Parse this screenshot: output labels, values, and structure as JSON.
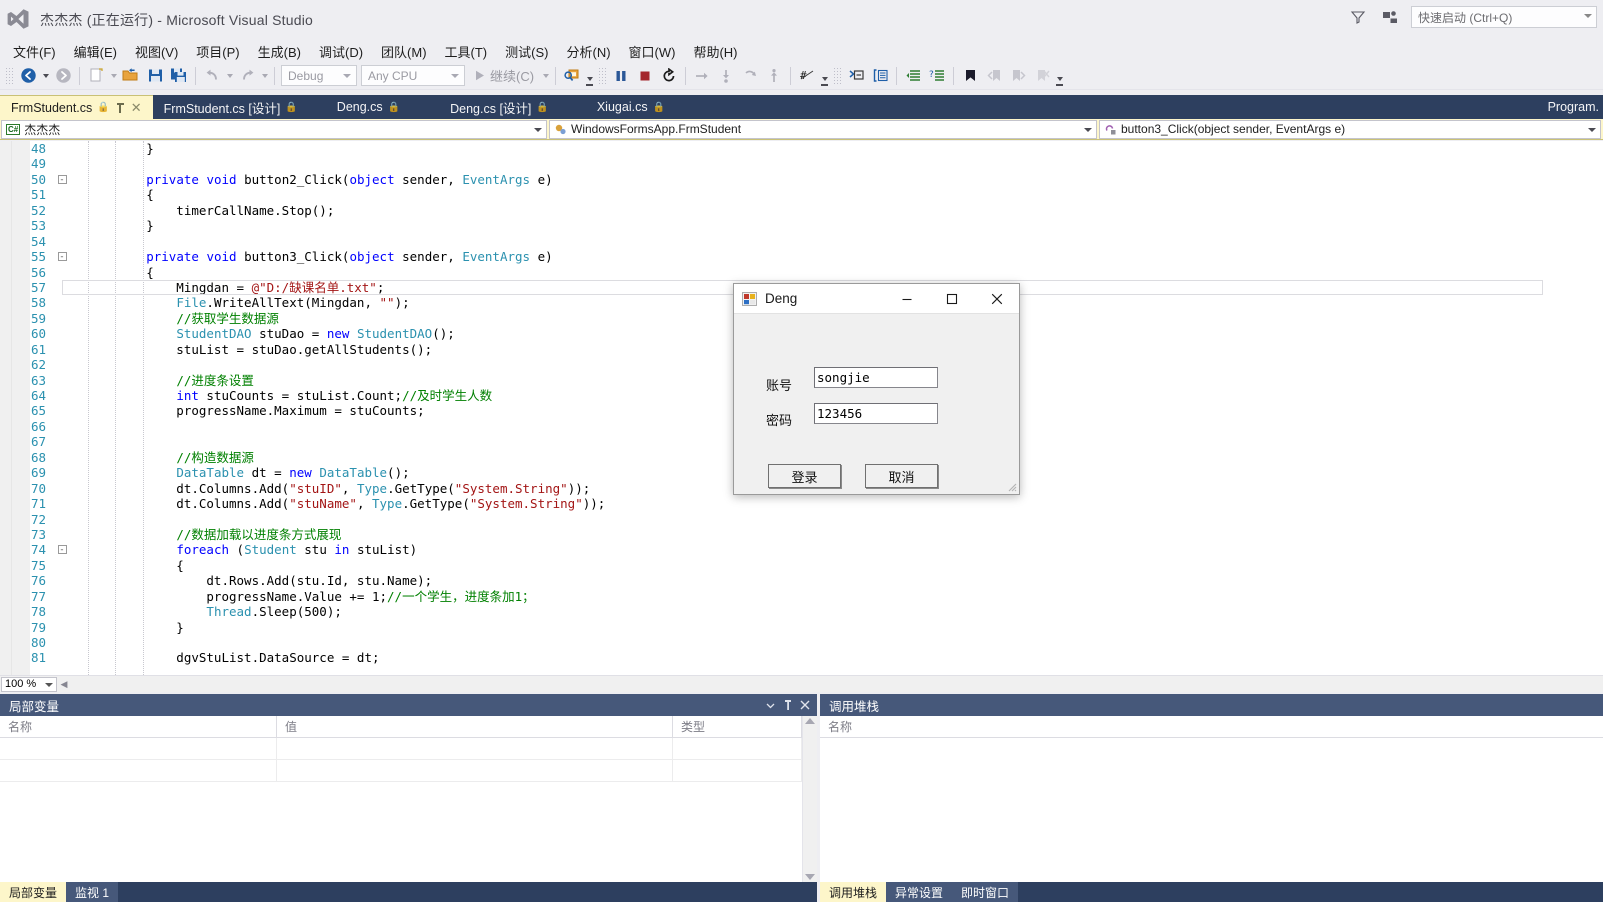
{
  "window": {
    "title": "杰杰杰 (正在运行) - Microsoft Visual Studio",
    "logo_icon": "visual-studio-logo",
    "feedback_icon": "feedback-icon",
    "notifications_icon": "notifications-icon",
    "quick_launch_placeholder": "快速启动 (Ctrl+Q)"
  },
  "menu": {
    "items": [
      {
        "label": "文件(F)"
      },
      {
        "label": "编辑(E)"
      },
      {
        "label": "视图(V)"
      },
      {
        "label": "项目(P)"
      },
      {
        "label": "生成(B)"
      },
      {
        "label": "调试(D)"
      },
      {
        "label": "团队(M)"
      },
      {
        "label": "工具(T)"
      },
      {
        "label": "测试(S)"
      },
      {
        "label": "分析(N)"
      },
      {
        "label": "窗口(W)"
      },
      {
        "label": "帮助(H)"
      }
    ]
  },
  "toolbar": {
    "config_value": "Debug",
    "platform_value": "Any CPU",
    "continue_label": "继续(C)",
    "icons": [
      "navigate-back-icon",
      "navigate-forward-icon",
      "new-project-icon",
      "open-file-icon",
      "save-icon",
      "save-all-icon",
      "undo-icon",
      "redo-icon",
      "start-debug-icon",
      "find-icon",
      "pause-icon",
      "stop-icon",
      "restart-icon",
      "step-over-icon",
      "step-into-icon",
      "step-out-icon",
      "show-next-statement-icon",
      "hex-display-icon",
      "comment-icon",
      "uncomment-icon",
      "decrease-indent-icon",
      "increase-indent-icon",
      "bookmark-icon",
      "prev-bookmark-icon",
      "next-bookmark-icon",
      "clear-bookmarks-icon"
    ]
  },
  "tabs": {
    "items": [
      {
        "label": "FrmStudent.cs",
        "active": true,
        "pinned": true,
        "locked": true
      },
      {
        "label": "FrmStudent.cs [设计]",
        "active": false,
        "locked": true
      },
      {
        "label": "Deng.cs",
        "active": false,
        "locked": true
      },
      {
        "label": "Deng.cs [设计]",
        "active": false,
        "locked": true
      },
      {
        "label": "Xiugai.cs",
        "active": false,
        "locked": true
      }
    ],
    "overflow_label": "Program."
  },
  "navbar": {
    "project": "杰杰杰",
    "project_icon": "csharp-icon",
    "type": "WindowsFormsApp.FrmStudent",
    "type_icon": "class-icon",
    "member": "button3_Click(object sender, EventArgs e)",
    "member_icon": "method-private-icon"
  },
  "editor": {
    "zoom": "100 %",
    "current_line": 57,
    "lines": [
      {
        "n": 48,
        "fold": "",
        "html": "        }"
      },
      {
        "n": 49,
        "fold": "",
        "html": ""
      },
      {
        "n": 50,
        "fold": "-",
        "html": "        <span class='kw'>private</span> <span class='kw'>void</span> button2_Click(<span class='kw'>object</span> sender, <span class='ty'>EventArgs</span> e)"
      },
      {
        "n": 51,
        "fold": "",
        "html": "        {"
      },
      {
        "n": 52,
        "fold": "",
        "html": "            timerCallName.Stop();"
      },
      {
        "n": 53,
        "fold": "",
        "html": "        }"
      },
      {
        "n": 54,
        "fold": "",
        "html": ""
      },
      {
        "n": 55,
        "fold": "-",
        "html": "        <span class='kw'>private</span> <span class='kw'>void</span> button3_Click(<span class='kw'>object</span> sender, <span class='ty'>EventArgs</span> e)"
      },
      {
        "n": 56,
        "fold": "",
        "html": "        {"
      },
      {
        "n": 57,
        "fold": "",
        "html": "            Mingdan = <span class='st'>@\"D:/缺课名单.txt\"</span>;"
      },
      {
        "n": 58,
        "fold": "",
        "html": "            <span class='ty'>File</span>.WriteAllText(Mingdan, <span class='st'>\"\"</span>);"
      },
      {
        "n": 59,
        "fold": "",
        "html": "            <span class='cm'>//获取学生数据源</span>"
      },
      {
        "n": 60,
        "fold": "",
        "html": "            <span class='ty'>StudentDAO</span> stuDao = <span class='kw'>new</span> <span class='ty'>StudentDAO</span>();"
      },
      {
        "n": 61,
        "fold": "",
        "html": "            stuList = stuDao.getAllStudents();"
      },
      {
        "n": 62,
        "fold": "",
        "html": ""
      },
      {
        "n": 63,
        "fold": "",
        "html": "            <span class='cm'>//进度条设置</span>"
      },
      {
        "n": 64,
        "fold": "",
        "html": "            <span class='kw'>int</span> stuCounts = stuList.Count;<span class='cm'>//及时学生人数</span>"
      },
      {
        "n": 65,
        "fold": "",
        "html": "            progressName.Maximum = stuCounts;"
      },
      {
        "n": 66,
        "fold": "",
        "html": ""
      },
      {
        "n": 67,
        "fold": "",
        "html": ""
      },
      {
        "n": 68,
        "fold": "",
        "html": "            <span class='cm'>//构造数据源</span>"
      },
      {
        "n": 69,
        "fold": "",
        "html": "            <span class='ty'>DataTable</span> dt = <span class='kw'>new</span> <span class='ty'>DataTable</span>();"
      },
      {
        "n": 70,
        "fold": "",
        "html": "            dt.Columns.Add(<span class='st'>\"stuID\"</span>, <span class='ty'>Type</span>.GetType(<span class='st'>\"System.String\"</span>));"
      },
      {
        "n": 71,
        "fold": "",
        "html": "            dt.Columns.Add(<span class='st'>\"stuName\"</span>, <span class='ty'>Type</span>.GetType(<span class='st'>\"System.String\"</span>));"
      },
      {
        "n": 72,
        "fold": "",
        "html": ""
      },
      {
        "n": 73,
        "fold": "",
        "html": "            <span class='cm'>//数据加载以进度条方式展现</span>"
      },
      {
        "n": 74,
        "fold": "-",
        "html": "            <span class='kw'>foreach</span> (<span class='ty'>Student</span> stu <span class='kw'>in</span> stuList)"
      },
      {
        "n": 75,
        "fold": "",
        "html": "            {"
      },
      {
        "n": 76,
        "fold": "",
        "html": "                dt.Rows.Add(stu.Id, stu.Name);"
      },
      {
        "n": 77,
        "fold": "",
        "html": "                progressName.Value += 1;<span class='cm'>//一个学生，进度条加1；</span>"
      },
      {
        "n": 78,
        "fold": "",
        "html": "                <span class='ty'>Thread</span>.Sleep(500);"
      },
      {
        "n": 79,
        "fold": "",
        "html": "            }"
      },
      {
        "n": 80,
        "fold": "",
        "html": ""
      },
      {
        "n": 81,
        "fold": "",
        "html": "            dgvStuList.DataSource = dt;"
      }
    ]
  },
  "locals_panel": {
    "title": "局部变量",
    "columns": [
      "名称",
      "值",
      "类型"
    ],
    "rows": [],
    "tabs": [
      {
        "label": "局部变量",
        "state": "active"
      },
      {
        "label": "监视 1",
        "state": "sel"
      }
    ]
  },
  "callstack_panel": {
    "title": "调用堆栈",
    "columns": [
      "名称"
    ],
    "rows": [],
    "tabs": [
      {
        "label": "调用堆栈",
        "state": "active"
      },
      {
        "label": "异常设置",
        "state": "sel"
      },
      {
        "label": "即时窗口",
        "state": "sel"
      }
    ]
  },
  "dialog": {
    "title": "Deng",
    "icon": "winforms-icon",
    "minimize_label": "−",
    "maximize_label": "□",
    "close_label": "✕",
    "fields": [
      {
        "label": "账号",
        "value": "songjie"
      },
      {
        "label": "密码",
        "value": "123456"
      }
    ],
    "buttons": [
      {
        "label": "登录"
      },
      {
        "label": "取消"
      }
    ]
  },
  "colors": {
    "accent_blue": "#2d3f5f",
    "panel_header": "#46587a",
    "active_tab": "#fdf6ca",
    "chrome": "#eeeef2",
    "keyword": "#0000ff",
    "type": "#2b91af",
    "string": "#a31515",
    "comment": "#008000"
  }
}
